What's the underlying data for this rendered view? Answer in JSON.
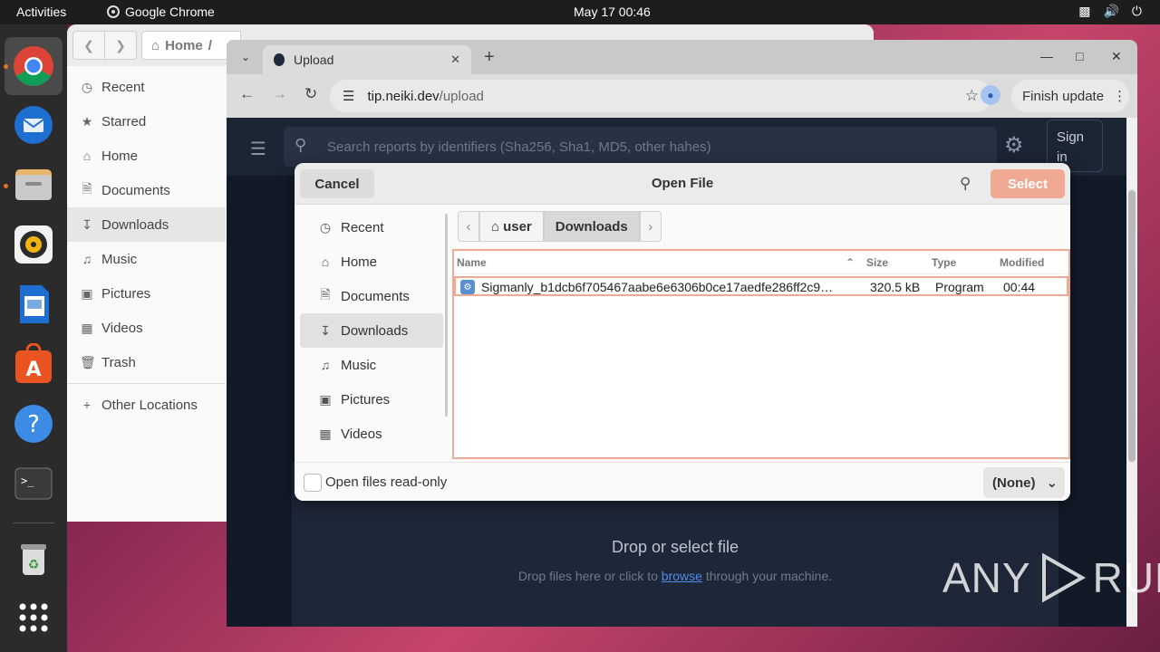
{
  "topbar": {
    "activities": "Activities",
    "app_name": "Google Chrome",
    "clock": "May 17  00:46"
  },
  "dock": {
    "items": [
      "chrome-icon",
      "thunderbird-icon",
      "files-icon",
      "rhythmbox-icon",
      "writer-icon",
      "app-center-icon",
      "help-icon",
      "terminal-icon",
      "trash-icon",
      "apps-grid-icon"
    ]
  },
  "files": {
    "path_home": "Home",
    "path_sep": "/",
    "sidebar": [
      {
        "label": "Recent",
        "icon": "clock-icon"
      },
      {
        "label": "Starred",
        "icon": "star-icon"
      },
      {
        "label": "Home",
        "icon": "home-icon"
      },
      {
        "label": "Documents",
        "icon": "document-icon"
      },
      {
        "label": "Downloads",
        "icon": "download-icon"
      },
      {
        "label": "Music",
        "icon": "music-icon"
      },
      {
        "label": "Pictures",
        "icon": "picture-icon"
      },
      {
        "label": "Videos",
        "icon": "video-icon"
      },
      {
        "label": "Trash",
        "icon": "trash-icon"
      },
      {
        "label": "Other Locations",
        "icon": "plus-icon"
      }
    ]
  },
  "chrome": {
    "tab_title": "Upload",
    "url_host": "tip.neiki.dev",
    "url_path": "/upload",
    "finish_update": "Finish update"
  },
  "page": {
    "search_placeholder": "Search reports by identifiers (Sha256, Sha1, MD5, other hahes)",
    "sign_in": "Sign in",
    "drop_title": "Drop or select file",
    "drop_sub_before": "Drop files here or click to ",
    "drop_sub_link": "browse",
    "drop_sub_after": " through your machine."
  },
  "dialog": {
    "cancel": "Cancel",
    "title": "Open File",
    "select": "Select",
    "places": [
      {
        "label": "Recent",
        "icon": "clock-icon"
      },
      {
        "label": "Home",
        "icon": "home-icon"
      },
      {
        "label": "Documents",
        "icon": "document-icon"
      },
      {
        "label": "Downloads",
        "icon": "download-icon"
      },
      {
        "label": "Music",
        "icon": "music-icon"
      },
      {
        "label": "Pictures",
        "icon": "picture-icon"
      },
      {
        "label": "Videos",
        "icon": "video-icon"
      }
    ],
    "crumbs": {
      "user": "user",
      "downloads": "Downloads"
    },
    "columns": {
      "name": "Name",
      "size": "Size",
      "type": "Type",
      "modified": "Modified"
    },
    "files": [
      {
        "name": "Sigmanly_b1dcb6f705467aabe6e6306b0ce17aedfe286ff2c9…",
        "size": "320.5 kB",
        "type": "Program",
        "modified": "00:44"
      }
    ],
    "readonly_label": "Open files read-only",
    "filter": "(None)"
  },
  "watermark": {
    "left": "ANY",
    "right": "RUN"
  },
  "colors": {
    "accent": "#f0a992",
    "dock": "#2b2b2b",
    "page_bg": "#121a28"
  }
}
